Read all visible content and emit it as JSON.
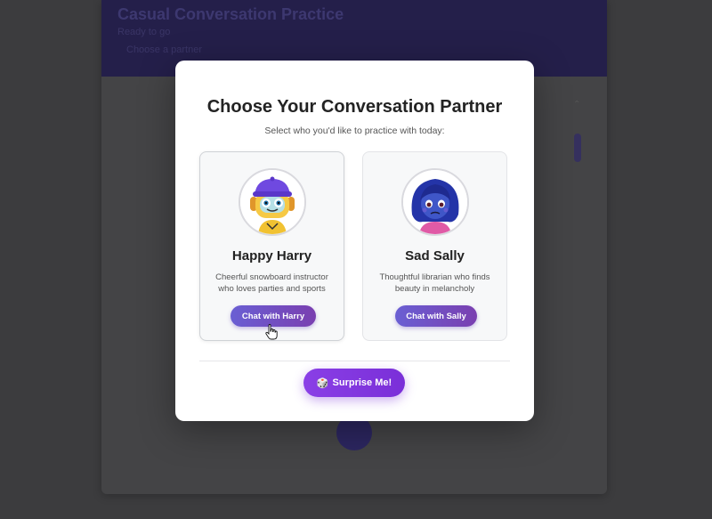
{
  "background": {
    "app_title": "Casual Conversation Practice",
    "app_subtitle": "Ready to go",
    "app_status": "Choose a partner"
  },
  "modal": {
    "title": "Choose Your Conversation Partner",
    "subtitle": "Select who you'd like to practice with today:",
    "partners": [
      {
        "name": "Happy Harry",
        "description": "Cheerful snowboard instructor who loves parties and sports",
        "button_label": "Chat with Harry",
        "avatar_icon": "robot-avatar-icon"
      },
      {
        "name": "Sad Sally",
        "description": "Thoughtful librarian who finds beauty in melancholy",
        "button_label": "Chat with Sally",
        "avatar_icon": "girl-avatar-icon"
      }
    ],
    "surprise_label": "Surprise Me!",
    "surprise_icon": "dice-icon"
  },
  "colors": {
    "accent_start": "#6a5fd3",
    "accent_end": "#7a3fb0",
    "surprise": "#8a3fe6"
  }
}
